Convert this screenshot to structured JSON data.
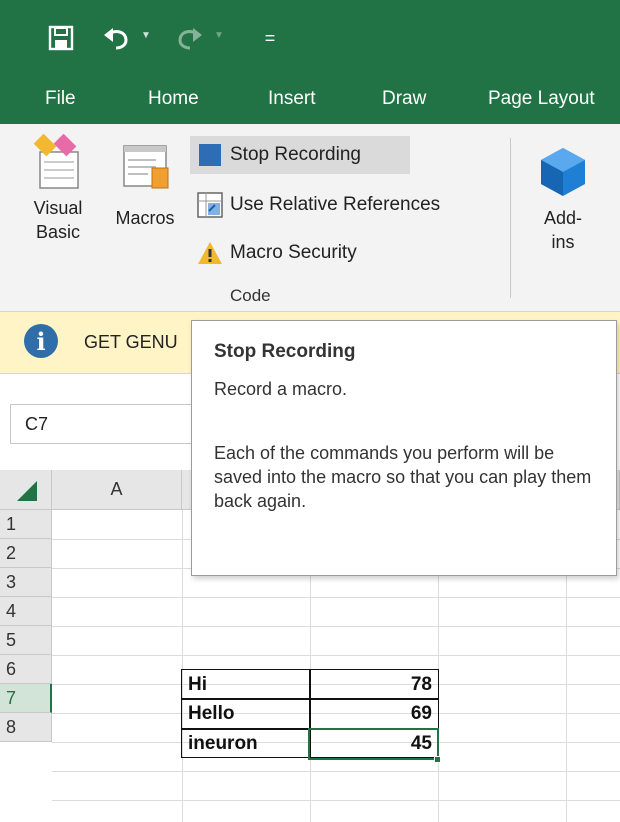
{
  "qat": {
    "icons": [
      "save-icon",
      "undo-icon",
      "redo-icon",
      "customize-qat-icon"
    ],
    "customize_glyph": "="
  },
  "tabs": [
    "File",
    "Home",
    "Insert",
    "Draw",
    "Page Layout"
  ],
  "ribbon": {
    "visual_basic": {
      "line1": "Visual",
      "line2": "Basic"
    },
    "macros": "Macros",
    "stop_recording": "Stop Recording",
    "use_relative_references": "Use Relative References",
    "macro_security": "Macro Security",
    "group_label": "Code",
    "addins": {
      "line1": "Add-",
      "line2": "ins"
    },
    "addins_icon": "add-ins-cube-icon"
  },
  "infobar": {
    "icon_glyph": "i",
    "text": "GET GENU"
  },
  "namebox": {
    "value": "C7"
  },
  "columns": [
    "A"
  ],
  "rows": [
    "1",
    "2",
    "3",
    "4",
    "5",
    "6",
    "7",
    "8"
  ],
  "active_row": "7",
  "table": [
    {
      "label": "Hi",
      "value": "78"
    },
    {
      "label": "Hello",
      "value": "69"
    },
    {
      "label": "ineuron",
      "value": "45"
    }
  ],
  "tooltip": {
    "title": "Stop Recording",
    "subtitle": "Record a macro.",
    "body": "Each of the commands you perform will be saved into the macro so that you can play them back again."
  },
  "colors": {
    "excel_green": "#217346",
    "infobar_bg": "#fff4c6",
    "info_icon": "#2f6ea8",
    "stop_square": "#2e6db5",
    "warning": "#f2b830",
    "addin_cube": "#1e7fd4"
  }
}
